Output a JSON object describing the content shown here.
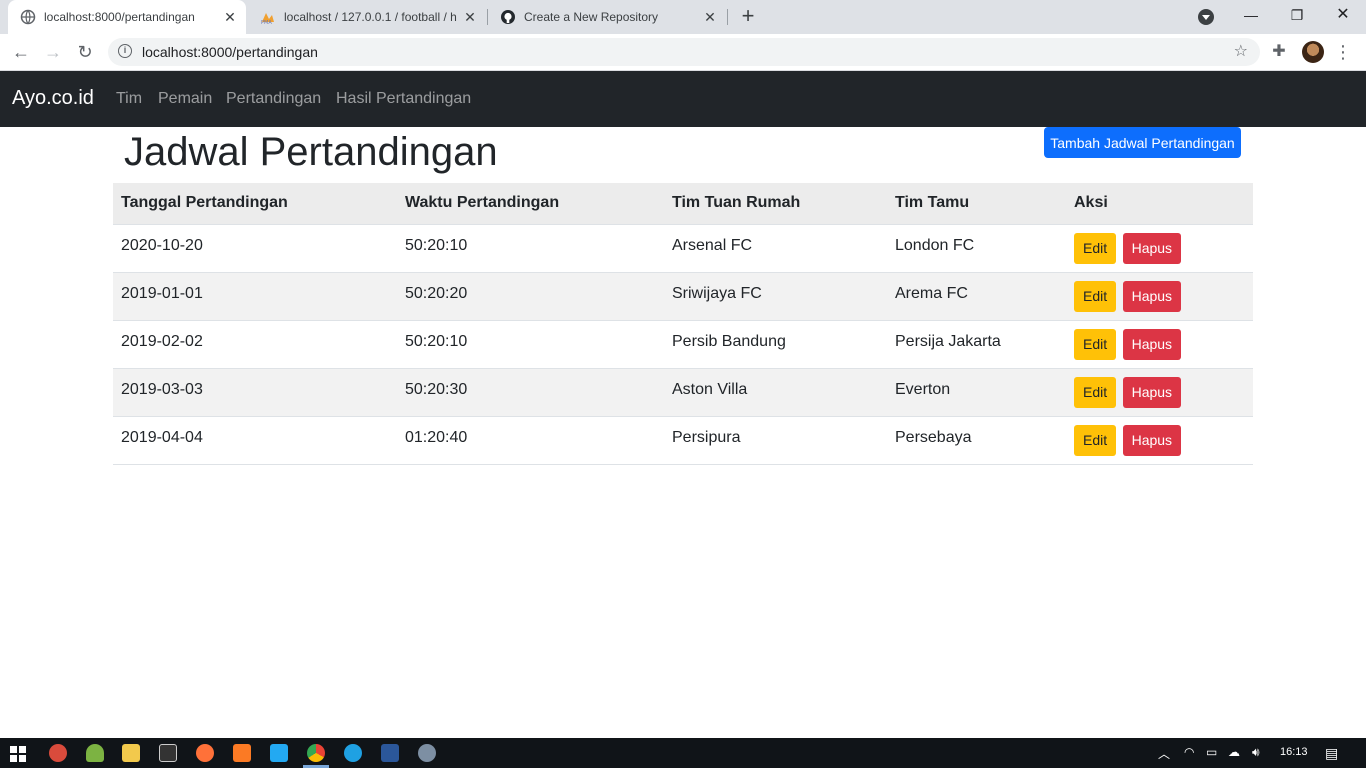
{
  "browser": {
    "tabs": [
      {
        "title": "localhost:8000/pertandingan",
        "icon": "globe-icon"
      },
      {
        "title": "localhost / 127.0.0.1 / football / h",
        "icon": "phpmyadmin-icon"
      },
      {
        "title": "Create a New Repository",
        "icon": "github-icon"
      }
    ],
    "url": "localhost:8000/pertandingan"
  },
  "navbar": {
    "brand": "Ayo.co.id",
    "links": [
      "Tim",
      "Pemain",
      "Pertandingan",
      "Hasil Pertandingan"
    ]
  },
  "page": {
    "title": "Jadwal Pertandingan",
    "add_button": "Tambah Jadwal Pertandingan"
  },
  "table": {
    "headers": [
      "Tanggal Pertandingan",
      "Waktu Pertandingan",
      "Tim Tuan Rumah",
      "Tim Tamu",
      "Aksi"
    ],
    "rows": [
      [
        "2020-10-20",
        "50:20:10",
        "Arsenal FC",
        "London FC"
      ],
      [
        "2019-01-01",
        "50:20:20",
        "Sriwijaya FC",
        "Arema FC"
      ],
      [
        "2019-02-02",
        "50:20:10",
        "Persib Bandung",
        "Persija Jakarta"
      ],
      [
        "2019-03-03",
        "50:20:30",
        "Aston Villa",
        "Everton"
      ],
      [
        "2019-04-04",
        "01:20:40",
        "Persipura",
        "Persebaya"
      ]
    ],
    "edit_label": "Edit",
    "delete_label": "Hapus"
  },
  "taskbar": {
    "time": "16:13"
  },
  "colors": {
    "primary": "#0d6efd",
    "warning": "#ffc107",
    "danger": "#dc3545",
    "navbar": "#212529"
  }
}
